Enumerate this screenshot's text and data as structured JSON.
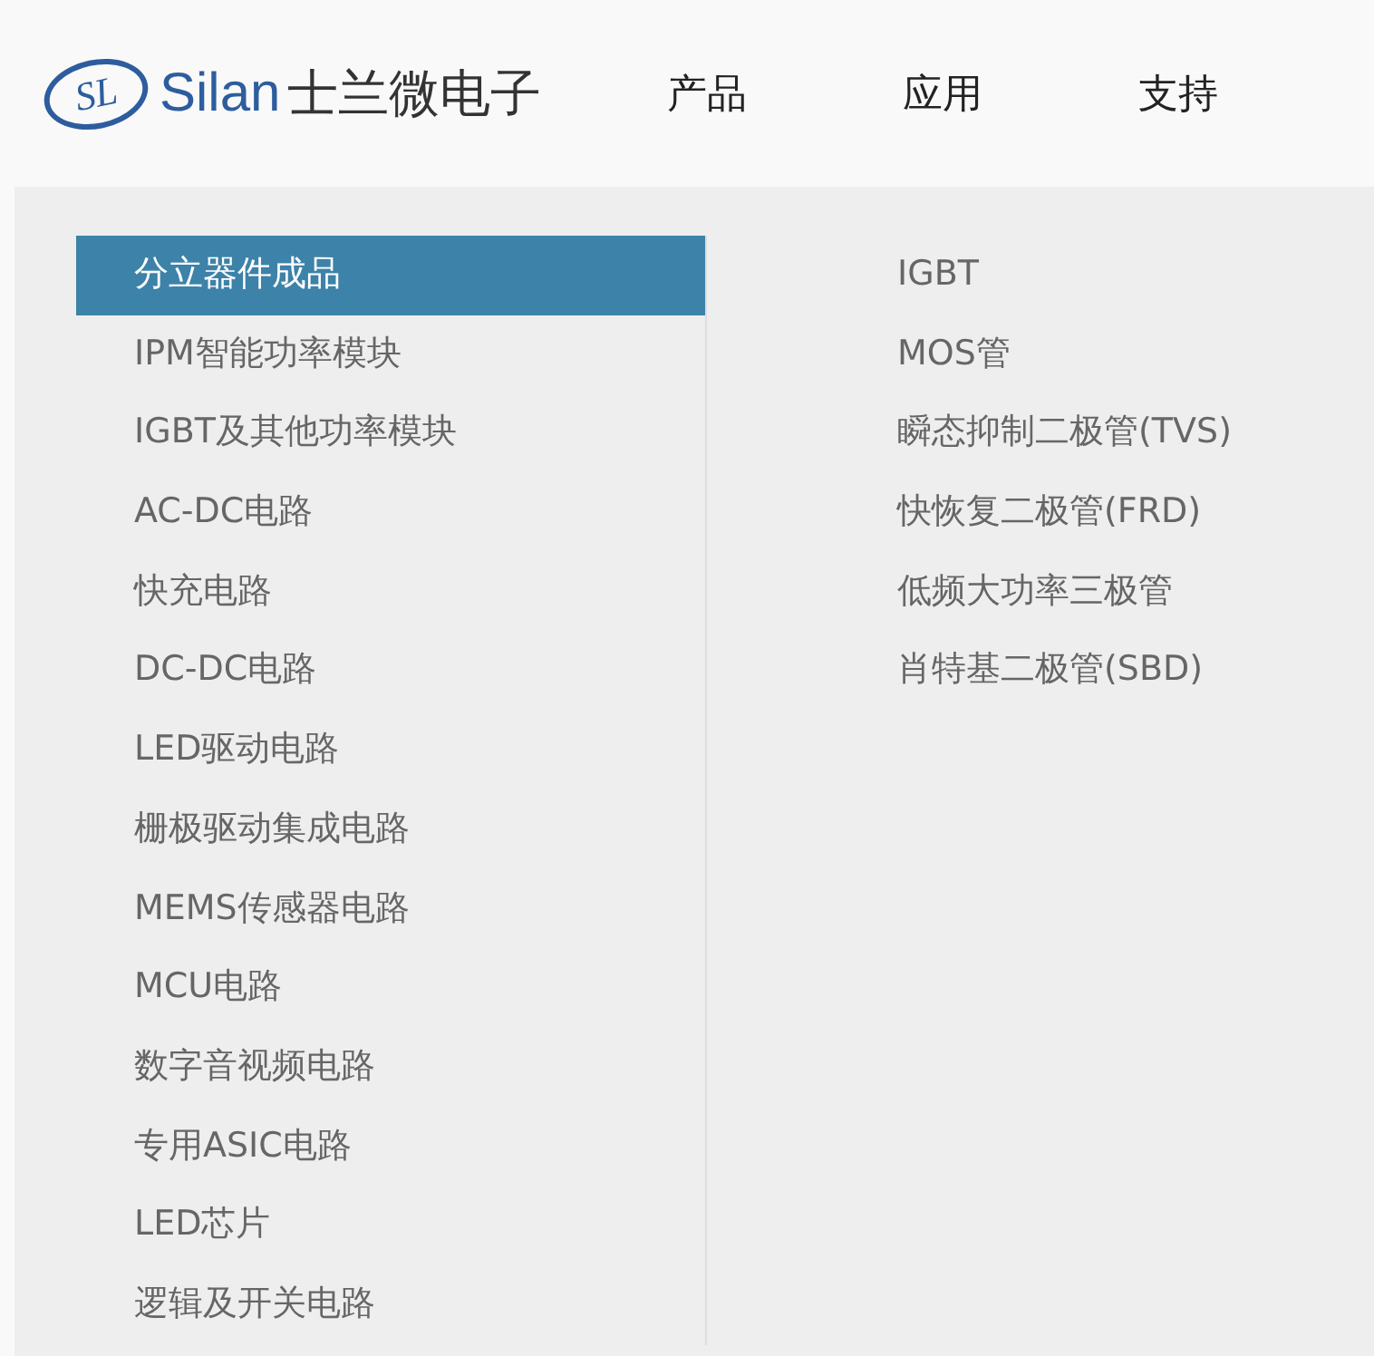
{
  "header": {
    "logo": {
      "mark": "SL",
      "brand": "Silan",
      "name": "士兰微电子"
    },
    "nav": [
      {
        "label": "产品"
      },
      {
        "label": "应用"
      },
      {
        "label": "支持"
      }
    ]
  },
  "menu": {
    "categories": [
      {
        "label": "分立器件成品",
        "selected": true
      },
      {
        "label": "IPM智能功率模块",
        "selected": false
      },
      {
        "label": "IGBT及其他功率模块",
        "selected": false
      },
      {
        "label": "AC-DC电路",
        "selected": false
      },
      {
        "label": "快充电路",
        "selected": false
      },
      {
        "label": "DC-DC电路",
        "selected": false
      },
      {
        "label": "LED驱动电路",
        "selected": false
      },
      {
        "label": "栅极驱动集成电路",
        "selected": false
      },
      {
        "label": "MEMS传感器电路",
        "selected": false
      },
      {
        "label": "MCU电路",
        "selected": false
      },
      {
        "label": "数字音视频电路",
        "selected": false
      },
      {
        "label": "专用ASIC电路",
        "selected": false
      },
      {
        "label": "LED芯片",
        "selected": false
      },
      {
        "label": "逻辑及开关电路",
        "selected": false
      }
    ],
    "subitems": [
      {
        "label": "IGBT"
      },
      {
        "label": "MOS管"
      },
      {
        "label": "瞬态抑制二极管(TVS)"
      },
      {
        "label": "快恢复二极管(FRD)"
      },
      {
        "label": "低频大功率三极管"
      },
      {
        "label": "肖特基二极管(SBD)"
      }
    ]
  }
}
